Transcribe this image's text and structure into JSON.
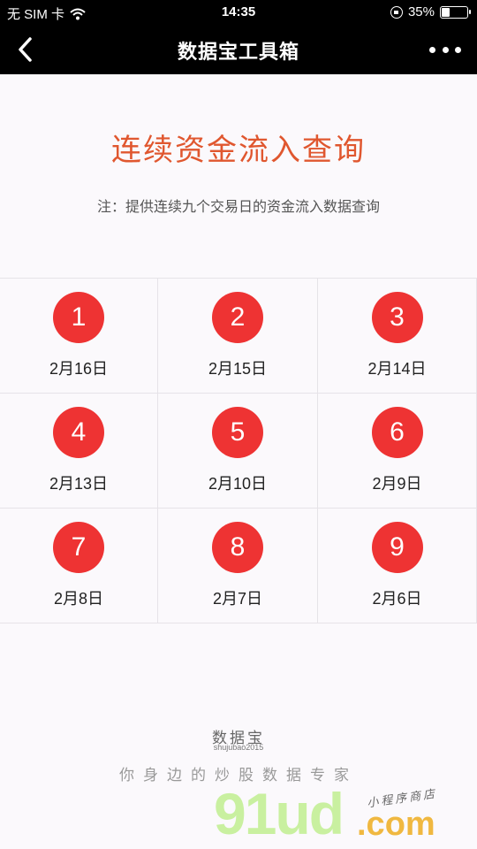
{
  "status": {
    "carrier": "无 SIM 卡",
    "time": "14:35",
    "battery_percent": "35%",
    "battery_level": 0.35,
    "icons": [
      "wifi-icon",
      "orientation-lock-icon",
      "battery-icon"
    ]
  },
  "nav": {
    "title": "数据宝工具箱",
    "icons": [
      "back-icon",
      "more-icon"
    ]
  },
  "page": {
    "title": "连续资金流入查询",
    "note": "注：提供连续九个交易日的资金流入数据查询"
  },
  "days": [
    {
      "num": "1",
      "date": "2月16日"
    },
    {
      "num": "2",
      "date": "2月15日"
    },
    {
      "num": "3",
      "date": "2月14日"
    },
    {
      "num": "4",
      "date": "2月13日"
    },
    {
      "num": "5",
      "date": "2月10日"
    },
    {
      "num": "6",
      "date": "2月9日"
    },
    {
      "num": "7",
      "date": "2月8日"
    },
    {
      "num": "8",
      "date": "2月7日"
    },
    {
      "num": "9",
      "date": "2月6日"
    }
  ],
  "footer": {
    "brand": "数据宝",
    "brand_sub": "shujubao2015",
    "slogan": "你身边的炒股数据专家"
  },
  "watermark": {
    "main": "91ud",
    "suffix": ".com",
    "tag": "小程序商店"
  },
  "colors": {
    "accent": "#e0572f",
    "circle": "#ee3333",
    "bar": "#000000"
  }
}
